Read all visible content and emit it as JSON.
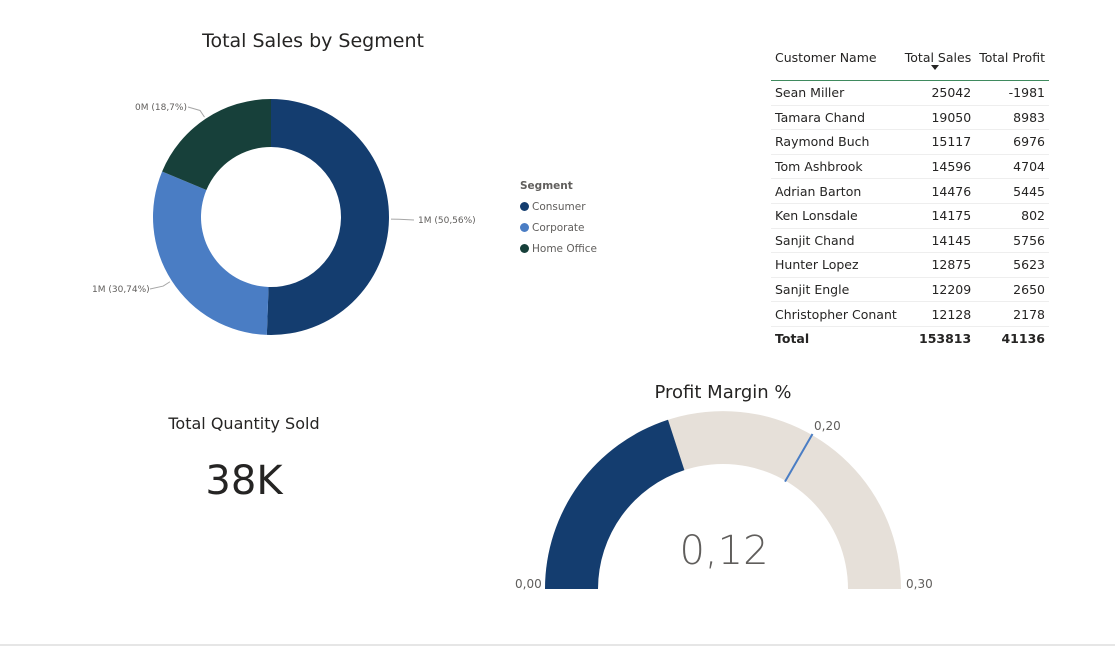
{
  "donut": {
    "title": "Total Sales by Segment",
    "legend_title": "Segment",
    "colors": {
      "Consumer": "#143d6f",
      "Corporate": "#4a7dc4",
      "Home Office": "#17403a"
    }
  },
  "chart_data": {
    "type": "pie",
    "title": "Total Sales by Segment",
    "categories": [
      "Consumer",
      "Corporate",
      "Home Office"
    ],
    "values": [
      50.56,
      30.74,
      18.7
    ],
    "data_labels": [
      "1M (50,56%)",
      "1M (30,74%)",
      "0M (18,7%)"
    ],
    "legend_title": "Segment",
    "legend_placement": "right",
    "donut": true
  },
  "table": {
    "headers": [
      "Customer Name",
      "Total Sales",
      "Total Profit"
    ],
    "rows": [
      [
        "Sean Miller",
        "25042",
        "-1981"
      ],
      [
        "Tamara Chand",
        "19050",
        "8983"
      ],
      [
        "Raymond Buch",
        "15117",
        "6976"
      ],
      [
        "Tom Ashbrook",
        "14596",
        "4704"
      ],
      [
        "Adrian Barton",
        "14476",
        "5445"
      ],
      [
        "Ken Lonsdale",
        "14175",
        "802"
      ],
      [
        "Sanjit Chand",
        "14145",
        "5756"
      ],
      [
        "Hunter Lopez",
        "12875",
        "5623"
      ],
      [
        "Sanjit Engle",
        "12209",
        "2650"
      ],
      [
        "Christopher Conant",
        "12128",
        "2178"
      ]
    ],
    "total": [
      "Total",
      "153813",
      "41136"
    ]
  },
  "kpi": {
    "label": "Total Quantity Sold",
    "value": "38K"
  },
  "gauge": {
    "title": "Profit Margin %",
    "value": 0.12,
    "value_label": "0,12",
    "min": 0,
    "max": 0.3,
    "target": 0.2,
    "min_label": "0,00",
    "max_label": "0,30",
    "target_label": "0,20",
    "fill_color": "#143d6f",
    "track_color": "#e6e0d9",
    "target_color": "#4a7dc4"
  }
}
